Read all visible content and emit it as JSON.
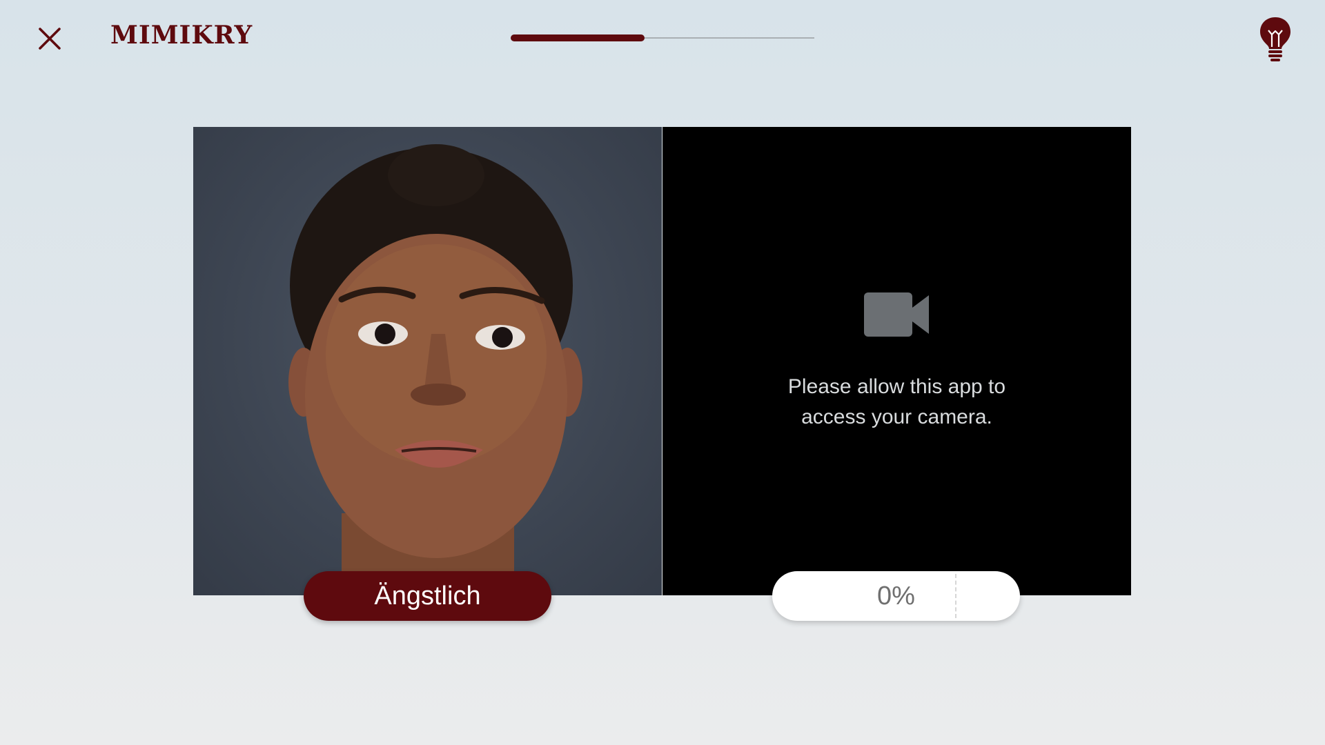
{
  "header": {
    "close_icon": "close-icon",
    "brand": "MIMIKRY",
    "progress_fraction": 0.44,
    "hint_icon": "lightbulb-icon"
  },
  "reference": {
    "emotion_label": "Ängstlich"
  },
  "camera": {
    "icon": "video-camera-icon",
    "message_line1": "Please allow this app to",
    "message_line2": "access your camera.",
    "score": "0%"
  },
  "colors": {
    "accent": "#5e0a0e",
    "background": "#dde5ea",
    "camera_background": "#000000"
  }
}
